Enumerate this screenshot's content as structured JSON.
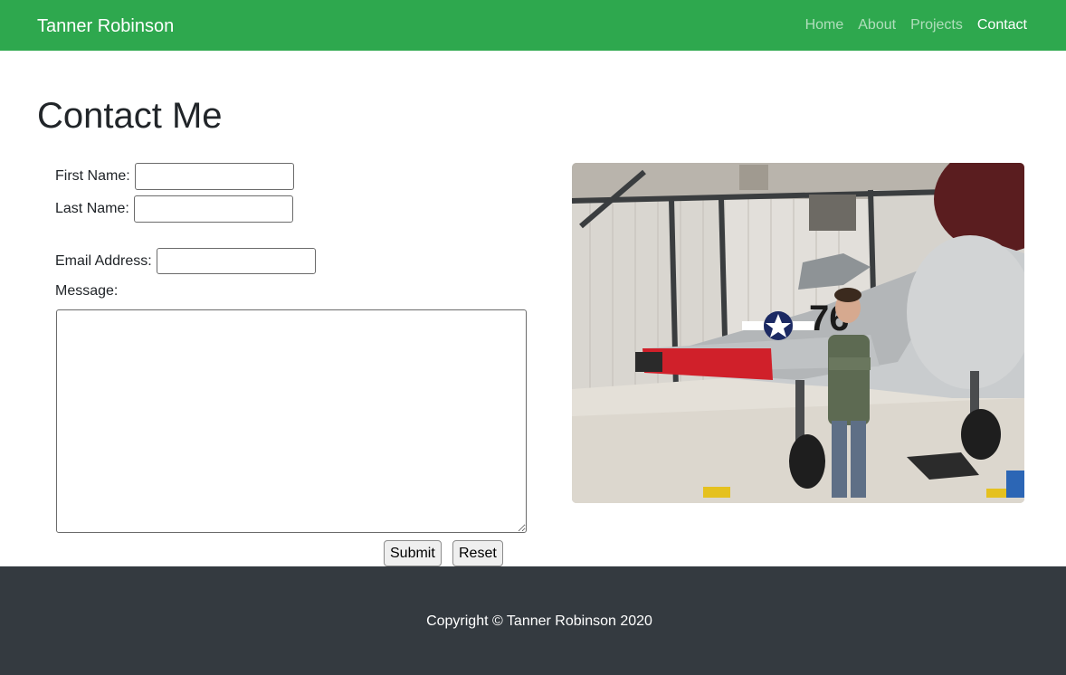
{
  "navbar": {
    "brand": "Tanner Robinson",
    "links": [
      {
        "label": "Home",
        "active": false
      },
      {
        "label": "About",
        "active": false
      },
      {
        "label": "Projects",
        "active": false
      },
      {
        "label": "Contact",
        "active": true
      }
    ],
    "background": "#2ea84e"
  },
  "main": {
    "title": "Contact Me",
    "form": {
      "first_name_label": "First Name:",
      "first_name_value": "",
      "last_name_label": "Last Name:",
      "last_name_value": "",
      "email_label": "Email Address:",
      "email_value": "",
      "message_label": "Message:",
      "message_value": "",
      "submit_label": "Submit",
      "reset_label": "Reset"
    },
    "photo": {
      "icon": "airplane-photo"
    }
  },
  "footer": {
    "copyright": "Copyright © Tanner Robinson 2020",
    "background": "#343a40"
  }
}
